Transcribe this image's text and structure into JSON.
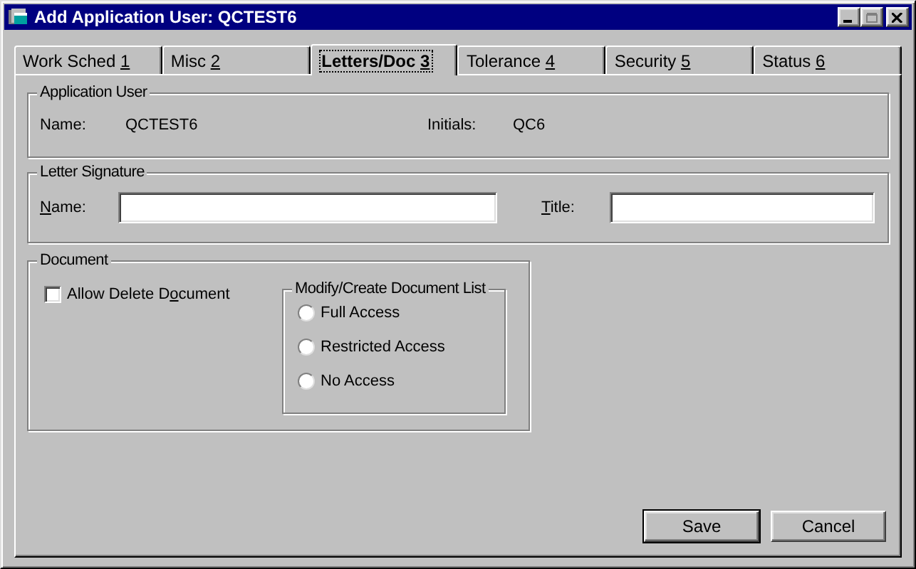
{
  "window": {
    "title": "Add Application User: QCTEST6"
  },
  "tabs": [
    {
      "text": "Work Sched ",
      "key": "1",
      "selected": false
    },
    {
      "text": "Misc ",
      "key": "2",
      "selected": false
    },
    {
      "text": "Letters/Doc ",
      "key": "3",
      "selected": true
    },
    {
      "text": "Tolerance ",
      "key": "4",
      "selected": false
    },
    {
      "text": "Security ",
      "key": "5",
      "selected": false
    },
    {
      "text": "Status ",
      "key": "6",
      "selected": false
    }
  ],
  "application_user": {
    "title": "Application User",
    "name_label": "Name:",
    "name_value": "QCTEST6",
    "initials_label": "Initials:",
    "initials_value": "QC6"
  },
  "letter_signature": {
    "title": "Letter Signature",
    "name_label": {
      "key": "N",
      "after": "ame:"
    },
    "title_label": {
      "key": "T",
      "after": "itle:"
    }
  },
  "document": {
    "title": "Document",
    "allow_delete": {
      "before": "Allow Delete D",
      "key": "o",
      "after": "cument",
      "checked": false
    },
    "list_group": {
      "title": "Modify/Create Document List",
      "options": [
        {
          "label": "Full Access",
          "selected": false
        },
        {
          "label": "Restricted Access",
          "selected": false
        },
        {
          "label": "No Access",
          "selected": false
        }
      ]
    }
  },
  "buttons": [
    {
      "label": "Save",
      "default": true
    },
    {
      "label": "Cancel",
      "default": false
    }
  ]
}
